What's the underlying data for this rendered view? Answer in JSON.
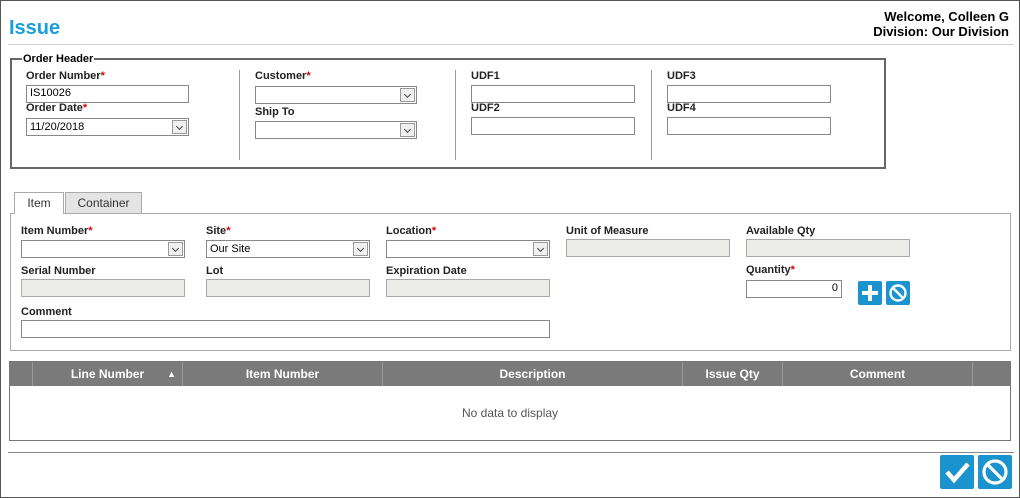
{
  "page": {
    "title": "Issue"
  },
  "user": {
    "welcome": "Welcome, Colleen G",
    "division": "Division: Our Division"
  },
  "order_header": {
    "legend": "Order Header",
    "order_number_label": "Order Number",
    "order_number_value": "IS10026",
    "order_date_label": "Order Date",
    "order_date_value": "11/20/2018",
    "customer_label": "Customer",
    "customer_value": "",
    "ship_to_label": "Ship To",
    "ship_to_value": "",
    "udf1_label": "UDF1",
    "udf2_label": "UDF2",
    "udf3_label": "UDF3",
    "udf4_label": "UDF4",
    "required_mark": "*"
  },
  "tabs": [
    {
      "label": "Item",
      "active": true
    },
    {
      "label": "Container",
      "active": false
    }
  ],
  "item": {
    "item_number_label": "Item Number",
    "item_number_value": "",
    "site_label": "Site",
    "site_value": "Our Site",
    "location_label": "Location",
    "location_value": "",
    "uom_label": "Unit of Measure",
    "available_qty_label": "Available Qty",
    "serial_number_label": "Serial Number",
    "lot_label": "Lot",
    "expiration_date_label": "Expiration Date",
    "quantity_label": "Quantity",
    "quantity_value": "0",
    "comment_label": "Comment",
    "comment_value": ""
  },
  "grid": {
    "columns": [
      "Line Number",
      "Item Number",
      "Description",
      "Issue Qty",
      "Comment"
    ],
    "sort_indicator": "▲",
    "empty_text": "No data to display"
  },
  "icons": {
    "add": "plus-icon",
    "cancel": "cancel-icon",
    "confirm": "check-icon"
  },
  "colors": {
    "accent": "#1b93cf",
    "title": "#1aa0d8",
    "grid_header": "#7a7a7a",
    "required": "#dd0000"
  }
}
